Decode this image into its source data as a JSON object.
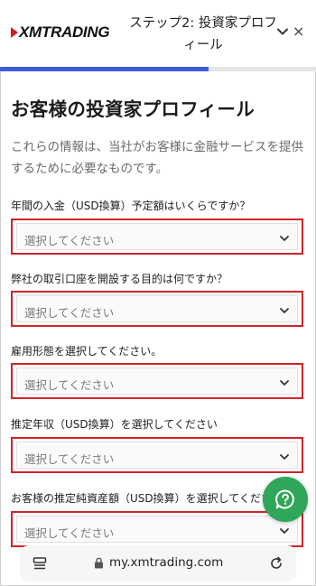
{
  "header": {
    "logo_text": "XMTRADING",
    "title_line1": "ステップ2: 投資家プロフ",
    "title_line2": "ィール",
    "chevron_icon": "chevron-down-icon",
    "close_label": "×",
    "progress": 0.66,
    "accent_color": "#3d5bdb"
  },
  "main": {
    "title": "お客様の投資家プロフィール",
    "intro": "これらの情報は、当社がお客様に金融サービスを提供するために必要なものです。",
    "questions": [
      {
        "label": "年間の入金（USD換算）予定額はいくらですか？",
        "placeholder": "選択してください"
      },
      {
        "label": "弊社の取引口座を開設する目的は何ですか？",
        "placeholder": "選択してください"
      },
      {
        "label": "雇用形態を選択してください。",
        "placeholder": "選択してください"
      },
      {
        "label": "推定年収（USD換算）を選択してください",
        "placeholder": "選択してください"
      },
      {
        "label": "お客様の推定純資産額（USD換算）を選択してくださ",
        "placeholder": "選択してください"
      }
    ],
    "highlight_color": "#d2232a"
  },
  "help_button": {
    "icon": "help-chat-icon",
    "color": "#2fa65a"
  },
  "browser": {
    "url": "my.xmtrading.com",
    "tabs_icon": "tabs-icon",
    "lock_icon": "lock-icon",
    "reload_icon": "reload-icon"
  }
}
